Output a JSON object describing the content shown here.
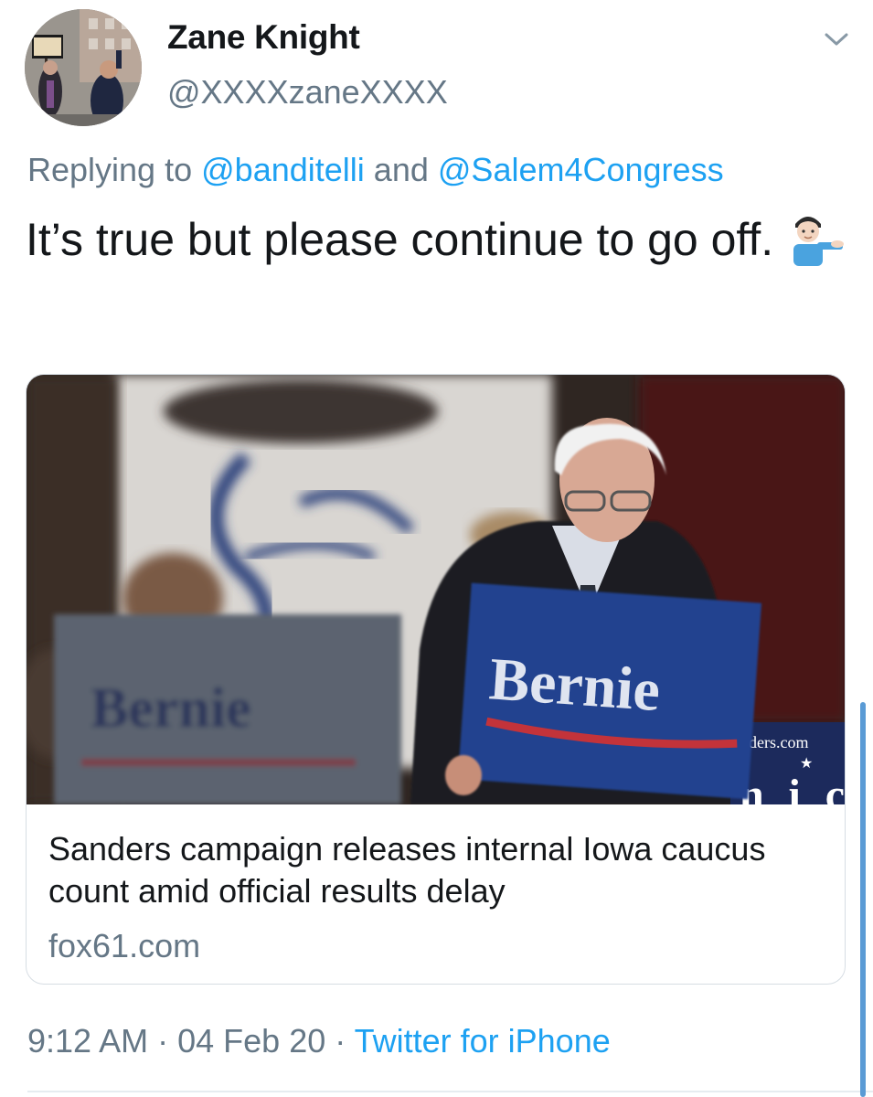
{
  "author": {
    "name": "Zane Knight",
    "handle": "@XXXXzaneXXXX"
  },
  "reply": {
    "prefix": "Replying to",
    "mention_1": "@banditelli",
    "conjunction": "and",
    "mention_2": "@Salem4Congress"
  },
  "tweet": {
    "text": "It’s true but please continue to go off.",
    "emoji": "man-tipping-hand-emoji"
  },
  "card": {
    "title": "Sanders campaign releases internal Iowa caucus count amid official results delay",
    "domain": "fox61.com",
    "sign_text": "Bernie",
    "banner_text": "ders.com"
  },
  "meta": {
    "time": "9:12 AM",
    "separator": "·",
    "date": "04 Feb 20",
    "source": "Twitter for iPhone"
  },
  "colors": {
    "link": "#1da1f2",
    "secondary_text": "#657786",
    "primary_text": "#14171a"
  }
}
